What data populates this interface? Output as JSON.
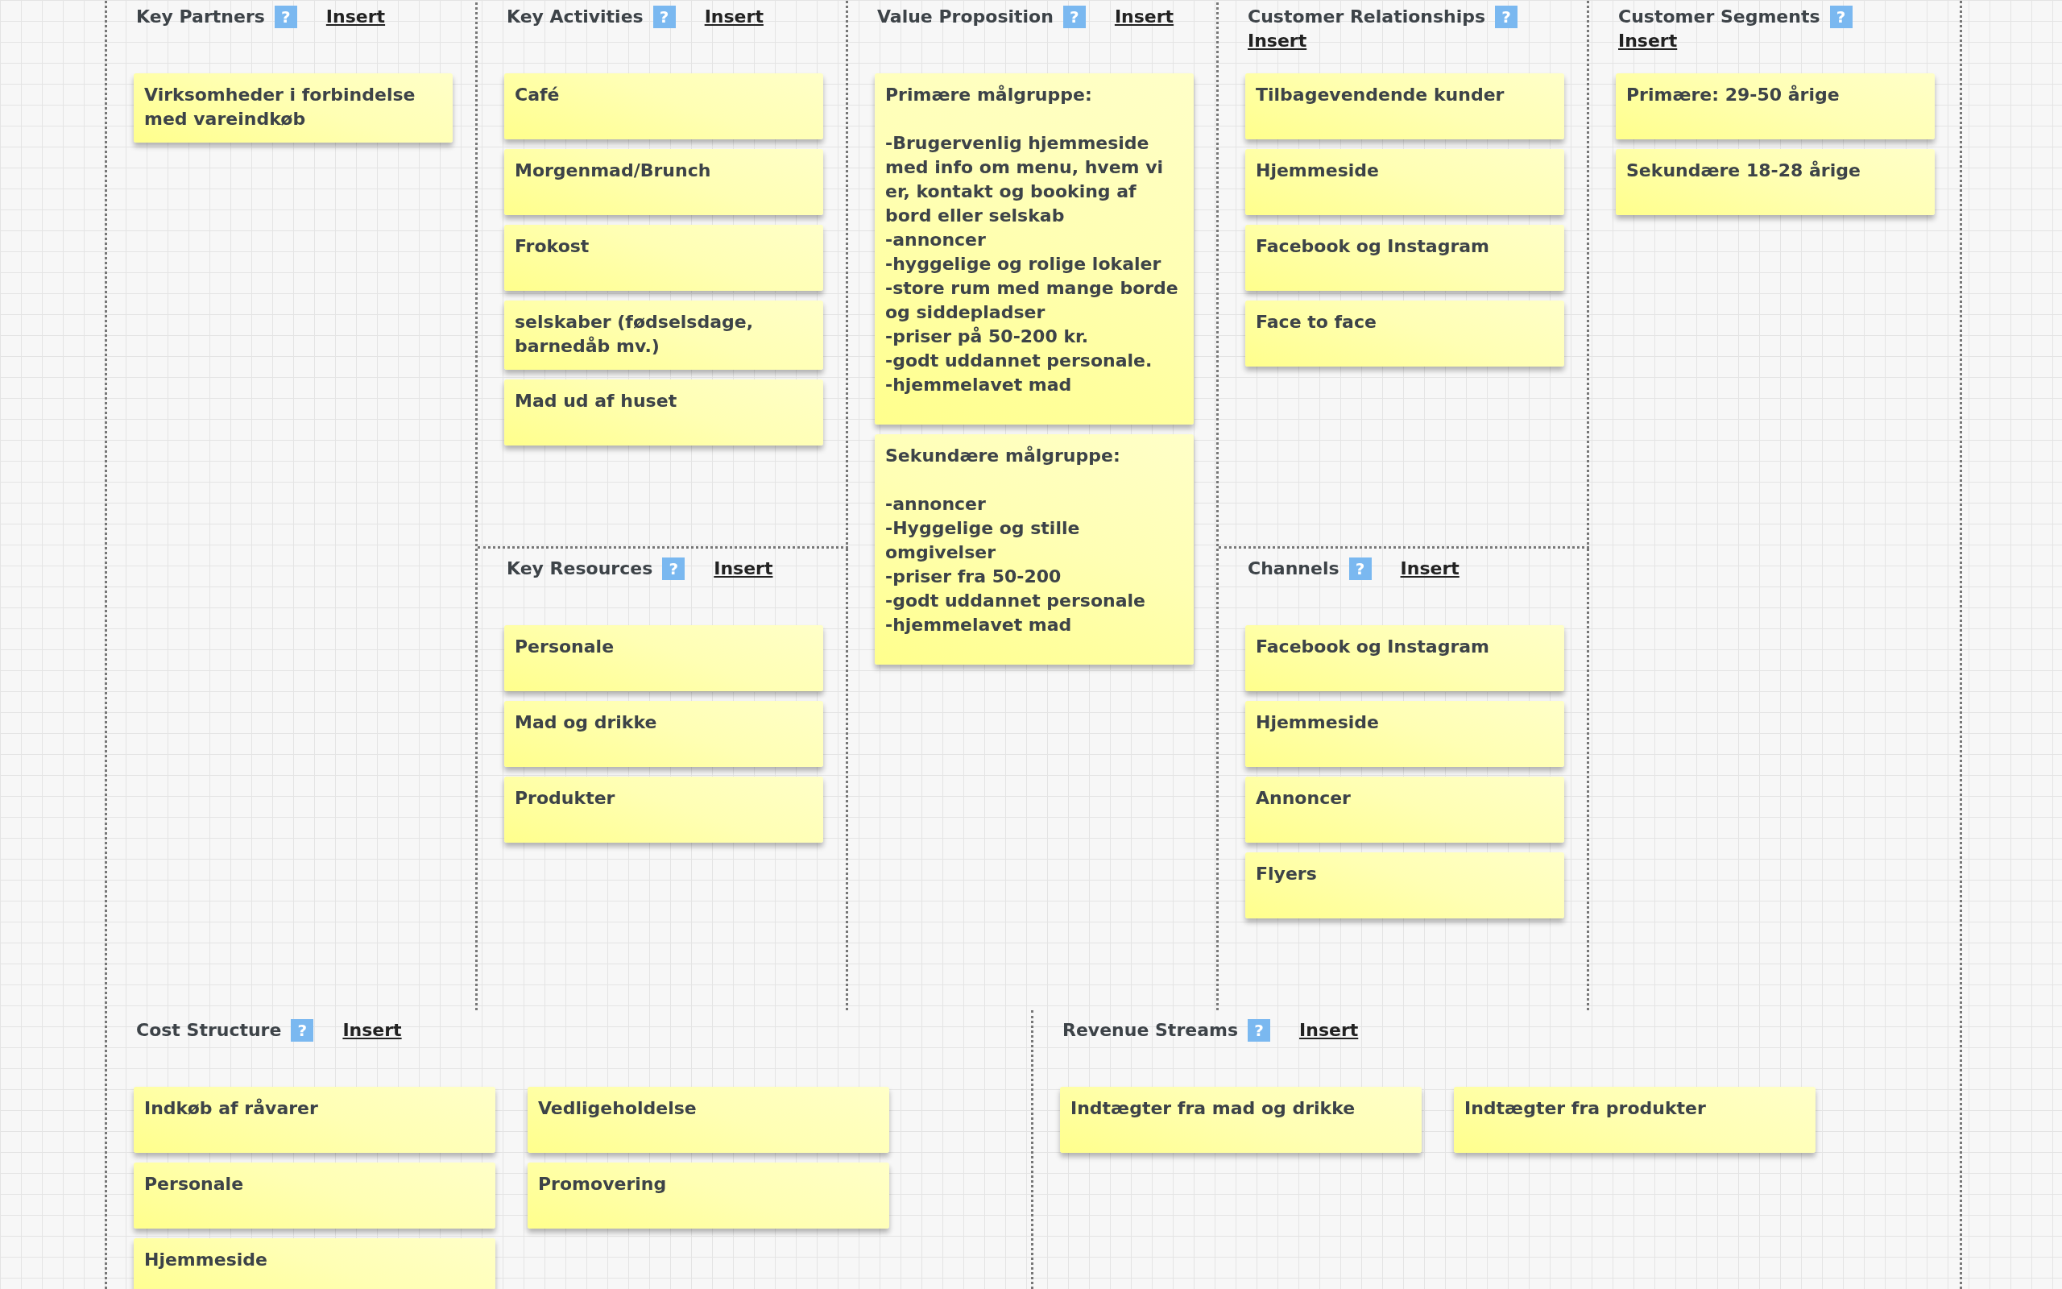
{
  "sections": [
    {
      "kind": "key_partners",
      "title": "Key Partners",
      "help": "?",
      "insert": "Insert",
      "notes": [
        "Virksomheder i forbindelse med vareindkøb"
      ]
    },
    {
      "kind": "key_activities",
      "title": "Key Activities",
      "help": "?",
      "insert": "Insert",
      "notes": [
        "Café",
        "Morgenmad/Brunch",
        "Frokost",
        "selskaber (fødselsdage, barnedåb mv.)",
        "Mad ud af huset"
      ]
    },
    {
      "kind": "key_resources",
      "title": "Key Resources",
      "help": "?",
      "insert": "Insert",
      "notes": [
        "Personale",
        "Mad og drikke",
        "Produkter"
      ]
    },
    {
      "kind": "value_proposition",
      "title": "Value Proposition",
      "help": "?",
      "insert": "Insert",
      "notes": [
        "Primære målgruppe:\n\n-Brugervenlig hjemmeside med info om menu, hvem vi er, kontakt og booking af bord eller selskab\n-annoncer\n-hyggelige og rolige lokaler\n-store rum med mange borde og siddepladser\n-priser på 50-200 kr.\n-godt uddannet personale.\n-hjemmelavet mad",
        "Sekundære målgruppe:\n\n-annoncer\n-Hyggelige og stille omgivelser\n-priser fra 50-200\n-godt uddannet personale\n-hjemmelavet mad"
      ]
    },
    {
      "kind": "customer_relationships",
      "title": "Customer Relationships",
      "help": "?",
      "insert": "Insert",
      "notes": [
        "Tilbagevendende kunder",
        "Hjemmeside",
        "Facebook og Instagram",
        "Face to face"
      ]
    },
    {
      "kind": "channels",
      "title": "Channels",
      "help": "?",
      "insert": "Insert",
      "notes": [
        "Facebook og Instagram",
        "Hjemmeside",
        "Annoncer",
        "Flyers"
      ]
    },
    {
      "kind": "customer_segments",
      "title": "Customer Segments",
      "help": "?",
      "insert": "Insert",
      "notes": [
        "Primære: 29-50 årige",
        "Sekundære 18-28 årige"
      ]
    },
    {
      "kind": "cost_structure",
      "title": "Cost Structure",
      "help": "?",
      "insert": "Insert",
      "notes": [
        "Indkøb af råvarer",
        "Vedligeholdelse",
        "Personale",
        "Promovering",
        "Hjemmeside"
      ]
    },
    {
      "kind": "revenue_streams",
      "title": "Revenue Streams",
      "help": "?",
      "insert": "Insert",
      "notes": [
        "Indtægter fra mad og drikke",
        "Indtægter fra produkter"
      ]
    }
  ]
}
